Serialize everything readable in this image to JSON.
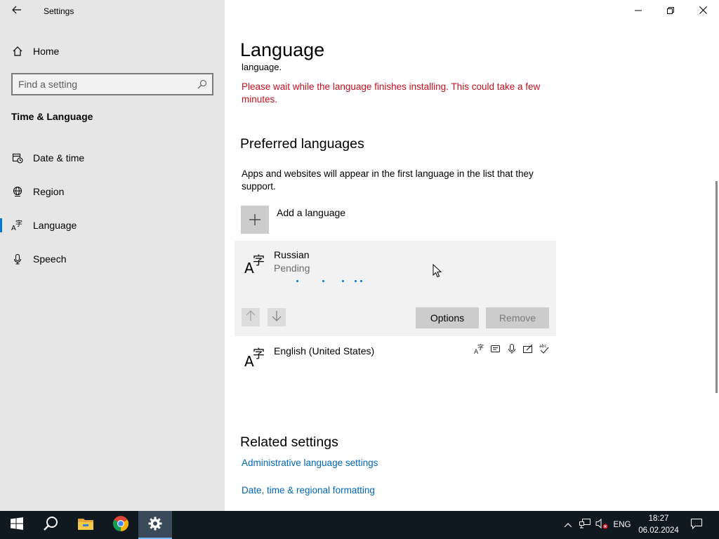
{
  "window": {
    "title": "Settings",
    "controls": {
      "minimize": "minimize",
      "maximize": "restore",
      "close": "close"
    }
  },
  "sidebar": {
    "home_label": "Home",
    "search_placeholder": "Find a setting",
    "group_title": "Time & Language",
    "items": [
      {
        "label": "Date & time",
        "icon": "calendar-clock-icon",
        "active": false
      },
      {
        "label": "Region",
        "icon": "globe-icon",
        "active": false
      },
      {
        "label": "Language",
        "icon": "language-icon",
        "active": true
      },
      {
        "label": "Speech",
        "icon": "microphone-icon",
        "active": false
      }
    ]
  },
  "main": {
    "title": "Language",
    "cut_text": "language.",
    "warning": "Please wait while the language finishes installing. This could take a few minutes.",
    "preferred": {
      "title": "Preferred languages",
      "description": "Apps and websites will appear in the first language in the list that they support.",
      "add_label": "Add a language",
      "languages": [
        {
          "name": "Russian",
          "status": "Pending",
          "expanded": true,
          "options_label": "Options",
          "remove_label": "Remove"
        },
        {
          "name": "English (United States)",
          "features": [
            "display-language-icon",
            "text-to-speech-icon",
            "speech-recognition-icon",
            "handwriting-icon",
            "spell-check-icon"
          ]
        }
      ]
    },
    "related": {
      "title": "Related settings",
      "links": [
        "Administrative language settings",
        "Date, time & regional formatting"
      ]
    }
  },
  "taskbar": {
    "apps": [
      "start-icon",
      "search-icon",
      "file-explorer-icon",
      "chrome-icon",
      "settings-icon"
    ],
    "language": "ENG",
    "time": "18:27",
    "date": "06.02.2024"
  },
  "colors": {
    "accent": "#0078d7",
    "warning": "#c50f1f",
    "link": "#0067b8",
    "sidebar_bg": "#e6e6e6",
    "taskbar_bg": "#101820"
  }
}
